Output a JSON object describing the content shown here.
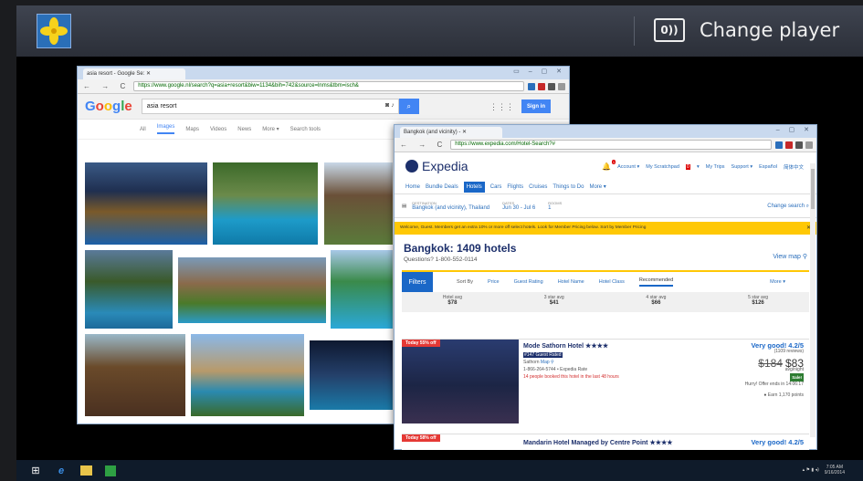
{
  "player": {
    "change_player_label": "Change player",
    "change_player_icon": "0))"
  },
  "google_window": {
    "tab_title": "asia resort - Google Se:",
    "url": "https://www.google.nl/search?q=asia+resort&biw=1134&bih=742&source=lnms&tbm=isch&",
    "logo": [
      "G",
      "o",
      "o",
      "g",
      "l",
      "e"
    ],
    "query": "asia resort",
    "sign_in": "Sign in",
    "tabs": [
      "All",
      "Images",
      "Maps",
      "Videos",
      "News",
      "More ▾",
      "Search tools"
    ],
    "active_tab": "Images"
  },
  "expedia_window": {
    "tab_title": "Bangkok (and vicinity) - ",
    "url": "https://www.expedia.com/Hotel-Search?#",
    "logo": "Expedia",
    "notifications": "1",
    "account_links": [
      "Account ▾",
      "My Scratchpad",
      "▾",
      "My Trips",
      "Support ▾",
      "Español",
      "简体中文"
    ],
    "scratchpad_count": "0",
    "nav": [
      "Home",
      "Bundle Deals",
      "Hotels",
      "Cars",
      "Flights",
      "Cruises",
      "Things to Do",
      "More ▾"
    ],
    "active_nav": "Hotels",
    "search": {
      "destination_label": "DESTINATION",
      "destination": "Bangkok (and vicinity), Thailand",
      "dates_label": "DATES",
      "dates": "Jun 30 - Jul 6",
      "rooms_label": "ROOMS",
      "rooms": "1",
      "change": "Change search"
    },
    "banner": "Welcome, Guest. Members get an extra 10% or more off select hotels. Look for Member Pricing below.  Sort by Member Pricing",
    "title": "Bangkok: 1409 hotels",
    "questions": "Questions? 1-800-552-0114",
    "view_map": "View map",
    "filters": "Filters",
    "sort": [
      "Sort By",
      "Price",
      "Guest Rating",
      "Hotel Name",
      "Hotel Class",
      "Recommended",
      "More ▾"
    ],
    "averages": [
      {
        "label": "Hotel avg",
        "value": "$78"
      },
      {
        "label": "3 star avg",
        "value": "$41"
      },
      {
        "label": "4 star avg",
        "value": "$66"
      },
      {
        "label": "5 star avg",
        "value": "$126"
      }
    ],
    "hotels": [
      {
        "badge": "Today 55% off",
        "name": "Mode Sathorn Hotel ★★★★",
        "tag": "#147 Guest Rated",
        "area": "Sathorn",
        "map": "Map",
        "phone": "1-866-264-5744  •  Expedia Rate",
        "booked": "14 people booked this hotel in the last 48 hours",
        "rating": "Very good! 4.2/5",
        "reviews": "(1109 reviews)",
        "old_price": "$184",
        "price": "$83",
        "per_night": "avg/night",
        "sale": "Sale!",
        "offer": "Hurry! Offer ends in 14:06:17",
        "earn": "Earn 1,170 points"
      },
      {
        "badge": "Today 58% off",
        "name": "Mandarin Hotel Managed by Centre Point ★★★★",
        "rating": "Very good! 4.2/5"
      }
    ]
  },
  "taskbar": {
    "time": "7:05 AM",
    "date": "9/16/2014"
  }
}
